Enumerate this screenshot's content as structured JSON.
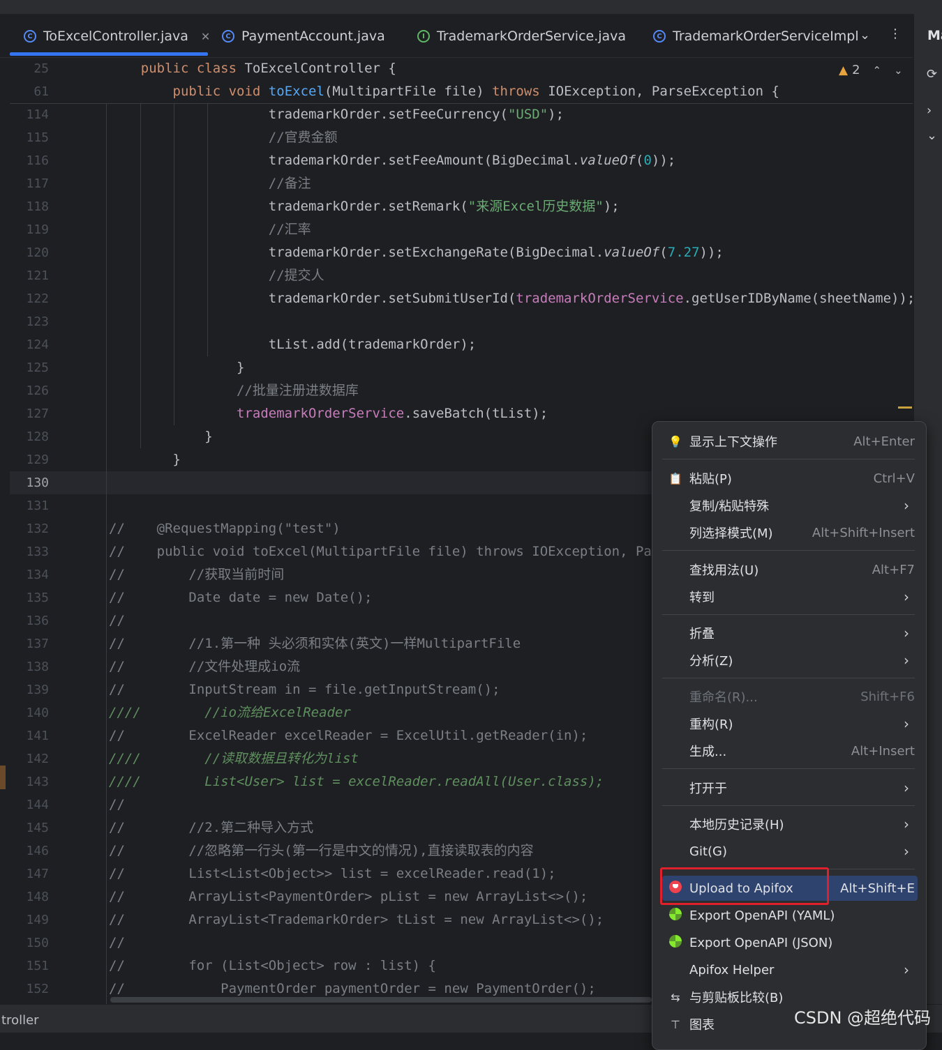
{
  "tabs": [
    {
      "label": "ToExcelController.java",
      "kind": "class",
      "active": true
    },
    {
      "label": "PaymentAccount.java",
      "kind": "class"
    },
    {
      "label": "TrademarkOrderService.java",
      "kind": "interface"
    },
    {
      "label": "TrademarkOrderServiceImpl",
      "kind": "class"
    }
  ],
  "right_panel": {
    "label": "Ma"
  },
  "inspections": {
    "warning_count": "2"
  },
  "code_lines": [
    {
      "n": "25",
      "html": "    <span class=\"kw\">public class</span> ToExcelController {"
    },
    {
      "n": "61",
      "html": "        <span class=\"kw\">public void</span> <span class=\"fn\">toExcel</span>(MultipartFile file) <span class=\"kw\">throws</span> IOException, ParseException {"
    },
    {
      "n": "114",
      "html": "                    trademarkOrder.setFeeCurrency(<span class=\"str\">\"USD\"</span>);"
    },
    {
      "n": "115",
      "html": "                    <span class=\"cm\">//官费金额</span>"
    },
    {
      "n": "116",
      "html": "                    trademarkOrder.setFeeAmount(BigDecimal.<span class=\"it\">valueOf</span>(<span class=\"num\">0</span>));"
    },
    {
      "n": "117",
      "html": "                    <span class=\"cm\">//备注</span>"
    },
    {
      "n": "118",
      "html": "                    trademarkOrder.setRemark(<span class=\"str\">\"来源Excel历史数据\"</span>);"
    },
    {
      "n": "119",
      "html": "                    <span class=\"cm\">//汇率</span>"
    },
    {
      "n": "120",
      "html": "                    trademarkOrder.setExchangeRate(BigDecimal.<span class=\"it\">valueOf</span>(<span class=\"num\">7.27</span>));"
    },
    {
      "n": "121",
      "html": "                    <span class=\"cm\">//提交人</span>"
    },
    {
      "n": "122",
      "html": "                    trademarkOrder.setSubmitUserId(<span class=\"fld\">trademarkOrderService</span>.getUserIDByName(sheetName));"
    },
    {
      "n": "123",
      "html": ""
    },
    {
      "n": "124",
      "html": "                    tList.add(trademarkOrder);"
    },
    {
      "n": "125",
      "html": "                }"
    },
    {
      "n": "126",
      "html": "                <span class=\"cm\">//批量注册进数据库</span>"
    },
    {
      "n": "127",
      "html": "                <span class=\"fld\">trademarkOrderService</span>.saveBatch(tList);"
    },
    {
      "n": "128",
      "html": "            }"
    },
    {
      "n": "129",
      "html": "        }"
    },
    {
      "n": "130",
      "html": "",
      "current": true
    },
    {
      "n": "131",
      "html": ""
    },
    {
      "n": "132",
      "html": "<span class=\"cm\">//    @RequestMapping(\"test\")</span>"
    },
    {
      "n": "133",
      "html": "<span class=\"cm\">//    public void toExcel(MultipartFile file) throws IOException, ParseException {</span>"
    },
    {
      "n": "134",
      "html": "<span class=\"cm\">//        //获取当前时间</span>"
    },
    {
      "n": "135",
      "html": "<span class=\"cm\">//        Date date = new Date();</span>"
    },
    {
      "n": "136",
      "html": "<span class=\"cm\">//</span>"
    },
    {
      "n": "137",
      "html": "<span class=\"cm\">//        //1.第一种 头必须和实体(英文)一样MultipartFile</span>"
    },
    {
      "n": "138",
      "html": "<span class=\"cm\">//        //文件处理成io流</span>"
    },
    {
      "n": "139",
      "html": "<span class=\"cm\">//        InputStream in = file.getInputStream();</span>"
    },
    {
      "n": "140",
      "html": "<span class=\"cmg\">////        //io流给ExcelReader</span>"
    },
    {
      "n": "141",
      "html": "<span class=\"cm\">//        ExcelReader excelReader = ExcelUtil.getReader(in);</span>"
    },
    {
      "n": "142",
      "html": "<span class=\"cmg\">////        //读取数据且转化为list</span>"
    },
    {
      "n": "143",
      "html": "<span class=\"cmg\">////        List&lt;User&gt; list = excelReader.readAll(User.class);</span>"
    },
    {
      "n": "144",
      "html": "<span class=\"cm\">//</span>"
    },
    {
      "n": "145",
      "html": "<span class=\"cm\">//        //2.第二种导入方式</span>"
    },
    {
      "n": "146",
      "html": "<span class=\"cm\">//        //忽略第一行头(第一行是中文的情况),直接读取表的内容</span>"
    },
    {
      "n": "147",
      "html": "<span class=\"cm\">//        List&lt;List&lt;Object&gt;&gt; list = excelReader.read(1);</span>"
    },
    {
      "n": "148",
      "html": "<span class=\"cm\">//        ArrayList&lt;PaymentOrder&gt; pList = new ArrayList&lt;&gt;();</span>"
    },
    {
      "n": "149",
      "html": "<span class=\"cm\">//        ArrayList&lt;TrademarkOrder&gt; tList = new ArrayList&lt;&gt;();</span>"
    },
    {
      "n": "150",
      "html": "<span class=\"cm\">//</span>"
    },
    {
      "n": "151",
      "html": "<span class=\"cm\">//        for (List&lt;Object&gt; row : list) {</span>"
    },
    {
      "n": "152",
      "html": "<span class=\"cm\">//            PaymentOrder paymentOrder = new PaymentOrder();</span>"
    }
  ],
  "context_menu": {
    "items": [
      {
        "label": "显示上下文操作",
        "shortcut": "Alt+Enter",
        "icon": "bulb-icon",
        "glyph": "💡"
      },
      {
        "label": "粘贴(P)",
        "shortcut": "Ctrl+V",
        "icon": "clipboard-icon",
        "glyph": "📋"
      },
      {
        "label": "复制/粘贴特殊",
        "submenu": true
      },
      {
        "label": "列选择模式(M)",
        "shortcut": "Alt+Shift+Insert"
      },
      {
        "label": "查找用法(U)",
        "shortcut": "Alt+F7"
      },
      {
        "label": "转到",
        "submenu": true
      },
      {
        "label": "折叠",
        "submenu": true
      },
      {
        "label": "分析(Z)",
        "submenu": true
      },
      {
        "label": "重命名(R)...",
        "shortcut": "Shift+F6",
        "disabled": true
      },
      {
        "label": "重构(R)",
        "submenu": true
      },
      {
        "label": "生成...",
        "shortcut": "Alt+Insert"
      },
      {
        "label": "打开于",
        "submenu": true
      },
      {
        "label": "本地历史记录(H)",
        "submenu": true
      },
      {
        "label": "Git(G)",
        "submenu": true
      },
      {
        "label": "Upload to Apifox",
        "shortcut": "Alt+Shift+E",
        "icon": "apifox-icon",
        "selected": true
      },
      {
        "label": "Export OpenAPI (YAML)",
        "icon": "openapi-icon"
      },
      {
        "label": "Export OpenAPI (JSON)",
        "icon": "openapi-icon"
      },
      {
        "label": "Apifox Helper",
        "submenu": true
      },
      {
        "label": "与剪贴板比较(B)",
        "icon": "compare-icon",
        "glyph": "⇆"
      },
      {
        "label": "图表",
        "icon": "diagram-icon",
        "glyph": "⊤"
      }
    ]
  },
  "status": {
    "text": "troller"
  },
  "watermark": "CSDN @超绝代码"
}
